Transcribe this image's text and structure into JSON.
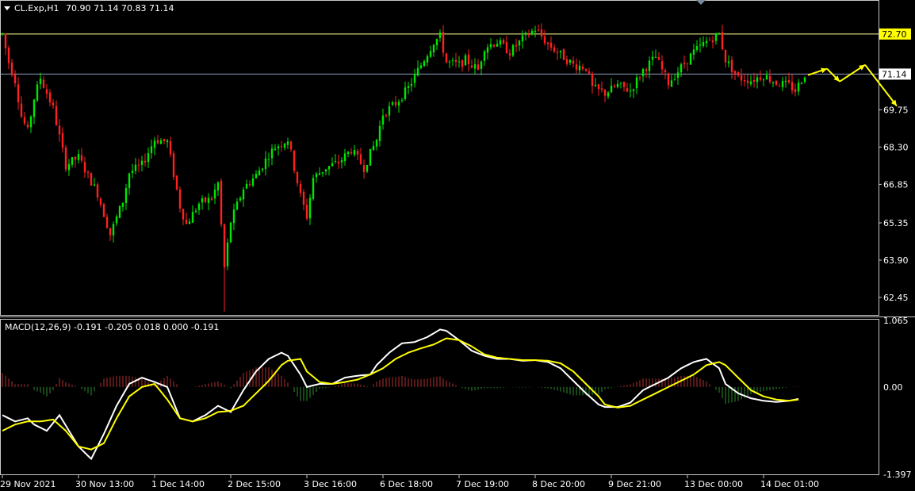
{
  "header": {
    "symbol": "CL.Exp,H1",
    "ohlc": "70.90 71.14 70.83 71.14",
    "macd_label": "MACD(12,26,9) -0.191 -0.205 0.018 0.000 -0.191"
  },
  "colors": {
    "background": "#000000",
    "bull": "#00e600",
    "bear": "#ff2020",
    "macd_line": "#ffffff",
    "signal_line": "#ffff00",
    "hist_pos": "#b03030",
    "hist_neg": "#2e8b2e",
    "level_line": "#ffff99",
    "price_line": "#8fa0c0",
    "arrow": "#ffff00"
  },
  "price_labels": {
    "level": "72.70",
    "current": "71.14"
  },
  "chart_data": [
    {
      "type": "candlestick",
      "ylim": [
        61.8,
        73.9
      ],
      "y_ticks": [
        "69.75",
        "68.30",
        "66.85",
        "65.35",
        "63.90",
        "62.45"
      ],
      "x_ticks": [
        "29 Nov 2021",
        "30 Nov 13:00",
        "1 Dec 14:00",
        "2 Dec 15:00",
        "3 Dec 16:00",
        "6 Dec 18:00",
        "7 Dec 19:00",
        "8 Dec 20:00",
        "9 Dec 21:00",
        "13 Dec 00:00",
        "14 Dec 01:00"
      ],
      "horizontal_levels": [
        72.7,
        71.14
      ],
      "anchors": [
        [
          0,
          72.7
        ],
        [
          2,
          71.6
        ],
        [
          4,
          70.9
        ],
        [
          6,
          69.5
        ],
        [
          8,
          68.9
        ],
        [
          10,
          70.2
        ],
        [
          12,
          71.0
        ],
        [
          16,
          69.8
        ],
        [
          20,
          67.6
        ],
        [
          24,
          67.9
        ],
        [
          30,
          66.5
        ],
        [
          34,
          64.9
        ],
        [
          38,
          66.2
        ],
        [
          40,
          67.3
        ],
        [
          44,
          67.6
        ],
        [
          48,
          68.6
        ],
        [
          52,
          68.5
        ],
        [
          56,
          66.0
        ],
        [
          58,
          65.3
        ],
        [
          62,
          66.1
        ],
        [
          66,
          66.3
        ],
        [
          68,
          66.9
        ],
        [
          70,
          63.6
        ],
        [
          72,
          65.4
        ],
        [
          76,
          66.7
        ],
        [
          80,
          67.2
        ],
        [
          84,
          68.0
        ],
        [
          86,
          68.3
        ],
        [
          90,
          68.6
        ],
        [
          94,
          66.4
        ],
        [
          96,
          65.6
        ],
        [
          98,
          67.1
        ],
        [
          102,
          67.5
        ],
        [
          106,
          67.7
        ],
        [
          110,
          68.2
        ],
        [
          114,
          67.5
        ],
        [
          118,
          68.6
        ],
        [
          120,
          69.6
        ],
        [
          124,
          70.0
        ],
        [
          128,
          70.6
        ],
        [
          132,
          71.5
        ],
        [
          136,
          72.4
        ],
        [
          138,
          72.6
        ],
        [
          140,
          71.6
        ],
        [
          144,
          71.5
        ],
        [
          146,
          71.7
        ],
        [
          150,
          71.3
        ],
        [
          152,
          72.2
        ],
        [
          156,
          72.4
        ],
        [
          160,
          72.0
        ],
        [
          164,
          72.5
        ],
        [
          168,
          72.9
        ],
        [
          172,
          72.3
        ],
        [
          176,
          71.9
        ],
        [
          180,
          71.5
        ],
        [
          184,
          71.4
        ],
        [
          186,
          70.6
        ],
        [
          190,
          70.4
        ],
        [
          194,
          70.7
        ],
        [
          198,
          70.5
        ],
        [
          202,
          71.3
        ],
        [
          206,
          71.8
        ],
        [
          210,
          70.8
        ],
        [
          214,
          71.4
        ],
        [
          218,
          72.0
        ],
        [
          222,
          72.4
        ],
        [
          226,
          72.7
        ],
        [
          228,
          71.7
        ],
        [
          232,
          71.0
        ],
        [
          236,
          70.9
        ],
        [
          240,
          71.1
        ],
        [
          244,
          70.8
        ],
        [
          248,
          70.7
        ],
        [
          250,
          70.5
        ],
        [
          253,
          71.14
        ]
      ],
      "forecast_arrows": [
        [
          [
            252,
            71.1
          ],
          [
            258,
            71.35
          ],
          [
            262,
            70.85
          ],
          [
            270,
            71.5
          ],
          [
            280,
            69.9
          ]
        ]
      ]
    },
    {
      "type": "macd",
      "params": "MACD(12,26,9)",
      "ylim": [
        -1.397,
        1.065
      ],
      "y_ticks": [
        "1.065",
        "0.00",
        "-1.397"
      ],
      "macd": [
        [
          0,
          -0.45
        ],
        [
          4,
          -0.55
        ],
        [
          8,
          -0.5
        ],
        [
          10,
          -0.6
        ],
        [
          14,
          -0.7
        ],
        [
          18,
          -0.45
        ],
        [
          24,
          -0.95
        ],
        [
          28,
          -1.15
        ],
        [
          32,
          -0.75
        ],
        [
          36,
          -0.3
        ],
        [
          40,
          0.05
        ],
        [
          44,
          0.15
        ],
        [
          48,
          0.08
        ],
        [
          52,
          0.0
        ],
        [
          56,
          -0.5
        ],
        [
          60,
          -0.55
        ],
        [
          64,
          -0.45
        ],
        [
          68,
          -0.3
        ],
        [
          72,
          -0.4
        ],
        [
          76,
          -0.05
        ],
        [
          80,
          0.25
        ],
        [
          84,
          0.45
        ],
        [
          88,
          0.55
        ],
        [
          90,
          0.5
        ],
        [
          94,
          0.2
        ],
        [
          96,
          0.0
        ],
        [
          100,
          0.05
        ],
        [
          104,
          0.05
        ],
        [
          108,
          0.15
        ],
        [
          112,
          0.18
        ],
        [
          116,
          0.2
        ],
        [
          118,
          0.35
        ],
        [
          122,
          0.55
        ],
        [
          126,
          0.7
        ],
        [
          130,
          0.72
        ],
        [
          134,
          0.8
        ],
        [
          138,
          0.92
        ],
        [
          140,
          0.9
        ],
        [
          144,
          0.75
        ],
        [
          148,
          0.58
        ],
        [
          152,
          0.5
        ],
        [
          156,
          0.45
        ],
        [
          160,
          0.45
        ],
        [
          164,
          0.42
        ],
        [
          168,
          0.43
        ],
        [
          172,
          0.4
        ],
        [
          176,
          0.3
        ],
        [
          180,
          0.1
        ],
        [
          184,
          -0.1
        ],
        [
          188,
          -0.28
        ],
        [
          190,
          -0.32
        ],
        [
          194,
          -0.32
        ],
        [
          198,
          -0.25
        ],
        [
          202,
          -0.05
        ],
        [
          206,
          0.05
        ],
        [
          210,
          0.15
        ],
        [
          214,
          0.3
        ],
        [
          218,
          0.4
        ],
        [
          222,
          0.45
        ],
        [
          226,
          0.3
        ],
        [
          228,
          0.05
        ],
        [
          232,
          -0.1
        ],
        [
          236,
          -0.18
        ],
        [
          240,
          -0.22
        ],
        [
          244,
          -0.24
        ],
        [
          248,
          -0.22
        ],
        [
          251,
          -0.19
        ]
      ],
      "signal": [
        [
          0,
          -0.7
        ],
        [
          4,
          -0.6
        ],
        [
          8,
          -0.55
        ],
        [
          12,
          -0.55
        ],
        [
          16,
          -0.52
        ],
        [
          20,
          -0.7
        ],
        [
          24,
          -0.95
        ],
        [
          28,
          -1.0
        ],
        [
          32,
          -0.9
        ],
        [
          36,
          -0.5
        ],
        [
          40,
          -0.15
        ],
        [
          44,
          0.0
        ],
        [
          48,
          0.05
        ],
        [
          52,
          -0.2
        ],
        [
          56,
          -0.5
        ],
        [
          60,
          -0.55
        ],
        [
          64,
          -0.5
        ],
        [
          68,
          -0.4
        ],
        [
          72,
          -0.38
        ],
        [
          76,
          -0.3
        ],
        [
          80,
          -0.1
        ],
        [
          84,
          0.1
        ],
        [
          88,
          0.35
        ],
        [
          90,
          0.42
        ],
        [
          94,
          0.45
        ],
        [
          96,
          0.25
        ],
        [
          100,
          0.08
        ],
        [
          104,
          0.05
        ],
        [
          108,
          0.08
        ],
        [
          112,
          0.12
        ],
        [
          116,
          0.2
        ],
        [
          120,
          0.3
        ],
        [
          124,
          0.45
        ],
        [
          128,
          0.55
        ],
        [
          132,
          0.62
        ],
        [
          136,
          0.68
        ],
        [
          140,
          0.78
        ],
        [
          144,
          0.75
        ],
        [
          148,
          0.65
        ],
        [
          152,
          0.52
        ],
        [
          156,
          0.47
        ],
        [
          160,
          0.45
        ],
        [
          164,
          0.43
        ],
        [
          168,
          0.43
        ],
        [
          172,
          0.42
        ],
        [
          176,
          0.38
        ],
        [
          180,
          0.25
        ],
        [
          184,
          0.05
        ],
        [
          188,
          -0.15
        ],
        [
          190,
          -0.28
        ],
        [
          194,
          -0.33
        ],
        [
          198,
          -0.3
        ],
        [
          202,
          -0.2
        ],
        [
          206,
          -0.1
        ],
        [
          210,
          0.0
        ],
        [
          214,
          0.1
        ],
        [
          218,
          0.2
        ],
        [
          222,
          0.35
        ],
        [
          226,
          0.4
        ],
        [
          228,
          0.35
        ],
        [
          232,
          0.15
        ],
        [
          236,
          -0.05
        ],
        [
          240,
          -0.15
        ],
        [
          244,
          -0.2
        ],
        [
          248,
          -0.22
        ],
        [
          251,
          -0.2
        ]
      ]
    }
  ]
}
